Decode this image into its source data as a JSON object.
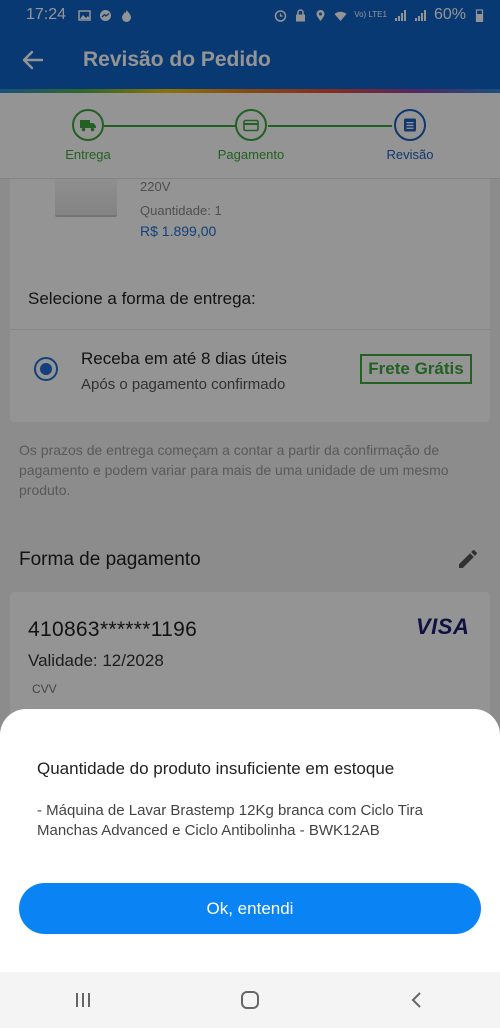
{
  "status_bar": {
    "time": "17:24",
    "battery": "60%",
    "network": "Vo) LTE1"
  },
  "header": {
    "title": "Revisão do Pedido"
  },
  "stepper": {
    "steps": [
      {
        "label": "Entrega",
        "icon": "truck-icon",
        "state": "done"
      },
      {
        "label": "Pagamento",
        "icon": "card-icon",
        "state": "done"
      },
      {
        "label": "Revisão",
        "icon": "list-icon",
        "state": "current"
      }
    ]
  },
  "product": {
    "voltage": "220V",
    "quantity_label": "Quantidade:  1",
    "price": "R$ 1.899,00"
  },
  "delivery": {
    "title": "Selecione a forma de entrega:",
    "option_main": "Receba em até 8 dias úteis",
    "option_sub": "Após o pagamento confirmado",
    "badge": "Frete Grátis",
    "info": "Os prazos de entrega começam a contar a partir da confirmação de pagamento e podem variar para mais de uma unidade de um mesmo produto."
  },
  "payment": {
    "heading": "Forma de pagamento",
    "card_number": "410863******1196",
    "brand": "VISA",
    "validity": "Validade: 12/2028",
    "cvv_label": "CVV"
  },
  "dialog": {
    "title": "Quantidade do produto insuficiente em estoque",
    "message": "- Máquina de Lavar Brastemp 12Kg branca com Ciclo Tira Manchas Advanced e Ciclo Antibolinha - BWK12AB",
    "button": "Ok, entendi"
  },
  "colors": {
    "primary": "#0e63c4",
    "success": "#3da63d",
    "button": "#0a84f5"
  }
}
